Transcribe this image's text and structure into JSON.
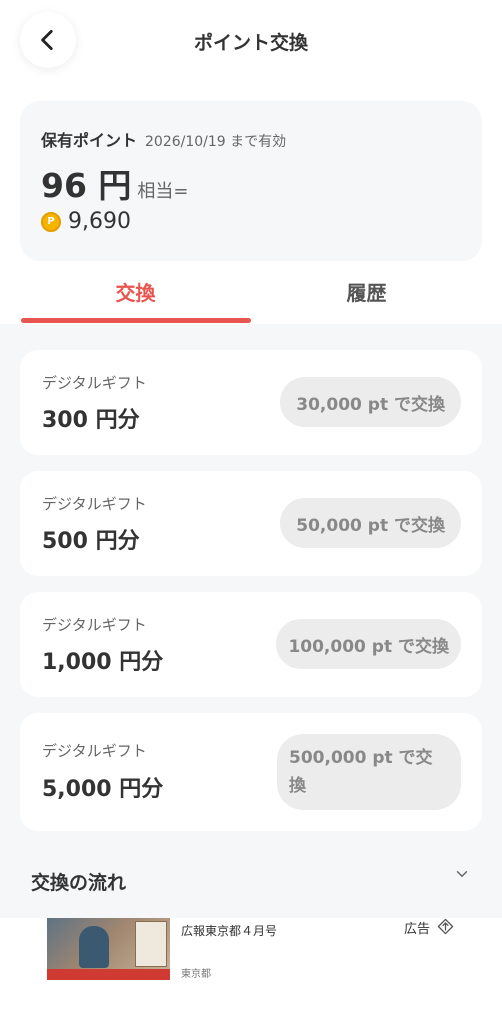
{
  "header": {
    "title": "ポイント交換",
    "back_icon": "chevron-left-icon"
  },
  "points": {
    "label": "保有ポイント",
    "expiry": "2026/10/19 まで有効",
    "yen_value": "96 円",
    "equivalent": "相当=",
    "coin_glyph": "P",
    "point_balance": "9,690"
  },
  "tabs": [
    {
      "label": "交換",
      "active": true
    },
    {
      "label": "履歴",
      "active": false
    }
  ],
  "accent_color": "#e8554e",
  "gifts": [
    {
      "type": "デジタルギフト",
      "amount": "300 円分",
      "button": "30,000 pt で交換"
    },
    {
      "type": "デジタルギフト",
      "amount": "500 円分",
      "button": "50,000 pt で交換"
    },
    {
      "type": "デジタルギフト",
      "amount": "1,000 円分",
      "button": "100,000 pt で交換"
    },
    {
      "type": "デジタルギフト",
      "amount": "5,000 円分",
      "button": "500,000 pt で交換"
    }
  ],
  "flow": {
    "title": "交換の流れ",
    "toggle_icon": "chevron-down-icon"
  },
  "ad": {
    "title": "広報東京都４月号",
    "source": "東京都",
    "label": "広告",
    "info_icon": "ad-info-icon"
  }
}
